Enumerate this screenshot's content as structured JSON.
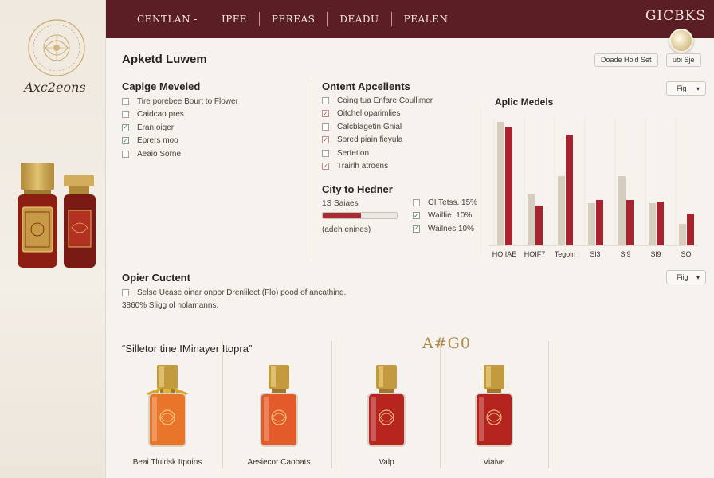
{
  "sidebar": {
    "brand_name": "Axc2eons",
    "seal_icon": "emblem-seal-icon",
    "hero_image": "perfume-bottles-icon"
  },
  "header": {
    "nav": [
      "CENTLAN -",
      "IPFE",
      "PEREAS",
      "DEADU",
      "PEALEN"
    ],
    "logo": "GICBKS",
    "avatar_icon": "user-avatar-icon"
  },
  "page": {
    "title": "Apketd Luwem",
    "button_primary": "Doade Hold Set",
    "button_secondary": "ubi Sje"
  },
  "capige": {
    "title": "Capige Meveled",
    "items": [
      {
        "label": "Tire porebee Bourt to Flower",
        "state": "empty"
      },
      {
        "label": "Caidcao pres",
        "state": "empty"
      },
      {
        "label": "Eran oiger",
        "state": "green"
      },
      {
        "label": "Eprers moo",
        "state": "green"
      },
      {
        "label": "Aeaio Sorne",
        "state": "empty"
      }
    ]
  },
  "ontent": {
    "title": "Ontent Apcelients",
    "items": [
      {
        "label": "Coing tua Enfare Coullimer",
        "state": "empty"
      },
      {
        "label": "Oitchel oparimlies",
        "state": "red"
      },
      {
        "label": "Calcblagetin Gnial",
        "state": "empty"
      },
      {
        "label": "Sored piain fieyula",
        "state": "red"
      },
      {
        "label": "Serfetion",
        "state": "empty"
      },
      {
        "label": "Trairlh atroens",
        "state": "red"
      }
    ]
  },
  "city": {
    "title": "City to Hedner",
    "series_label": "1S Saiaes",
    "progress": 0.52,
    "progress_caption": "(adeh enines)",
    "checks": [
      {
        "label": "OI Tetss. 15%",
        "state": "empty"
      },
      {
        "label": "Wailfie. 10%",
        "state": "green"
      },
      {
        "label": "Wailnes 10%",
        "state": "green"
      }
    ]
  },
  "chart_select": "Fig",
  "bottom_select": "Fiig",
  "chart_data": {
    "type": "bar",
    "title": "Aplic Medels",
    "categories": [
      "HOIIAE",
      "HOIF7",
      "Tegoln",
      "Sl3",
      "Sl9",
      "Sl9",
      "SO"
    ],
    "series": [
      {
        "color": "#d6cdbf",
        "values": [
          155,
          64,
          87,
          53,
          87,
          53,
          27
        ]
      },
      {
        "color": "#a8222f",
        "values": [
          148,
          50,
          139,
          57,
          57,
          55,
          40
        ]
      }
    ]
  },
  "opier": {
    "title": "Opier Cuctent",
    "line1": "Selse Ucase oinar onpor Drenlilect (Flo) pood of ancathing.",
    "line2": "3860% Sligg ol nolamanns."
  },
  "products": {
    "title": "“Silletor tine IMinayer Itopra”",
    "script_logo": "A#G0",
    "items": [
      {
        "label": "Beai Tluldsk Itpoins",
        "liquid": "#e8752a",
        "bow": true
      },
      {
        "label": "Aesiecor Caobats",
        "liquid": "#e35b2a",
        "bow": false
      },
      {
        "label": "Valp",
        "liquid": "#b8251f",
        "bow": false
      },
      {
        "label": "Viaive",
        "liquid": "#b4231d",
        "bow": false
      }
    ]
  }
}
